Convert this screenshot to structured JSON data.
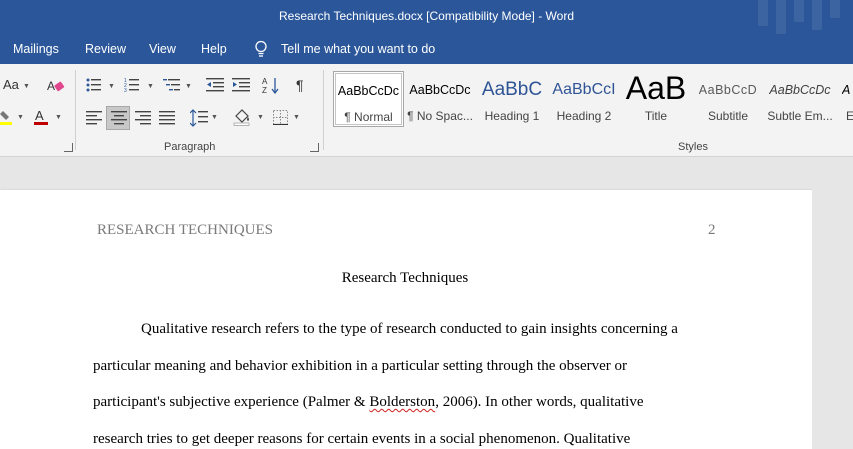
{
  "titlebar": {
    "title": "Research Techniques.docx [Compatibility Mode]  -  Word"
  },
  "menu": {
    "tabs": [
      "Mailings",
      "Review",
      "View",
      "Help"
    ],
    "tell_me": "Tell me what you want to do"
  },
  "ribbon": {
    "font_group": {
      "change_case": "Aa"
    },
    "paragraph_group": {
      "label": "Paragraph"
    },
    "styles_group": {
      "label": "Styles",
      "items": [
        {
          "preview": "AaBbCcDc",
          "name": "¶ Normal"
        },
        {
          "preview": "AaBbCcDc",
          "name": "¶ No Spac..."
        },
        {
          "preview": "AaBbC",
          "name": "Heading 1"
        },
        {
          "preview": "AaBbCcI",
          "name": "Heading 2"
        },
        {
          "preview": "AaB",
          "name": "Title"
        },
        {
          "preview": "AaBbCcD",
          "name": "Subtitle"
        },
        {
          "preview": "AaBbCcDc",
          "name": "Subtle Em..."
        },
        {
          "preview": "A",
          "name": "E"
        }
      ]
    },
    "colors": {
      "highlight": "#ffff00",
      "font_color": "#c00000"
    }
  },
  "document": {
    "header_left": "RESEARCH TECHNIQUES",
    "header_right": "2",
    "title": "Research Techniques",
    "lines": [
      "Qualitative research refers to the type of research conducted to gain insights concerning a",
      "particular meaning and behavior exhibition in a particular setting through the observer or",
      {
        "before": "participant's subjective experience (Palmer & ",
        "flagged": "Bolderston",
        "after": ", 2006). In other words, qualitative"
      },
      "research tries to get deeper reasons for certain events in a social phenomenon. Qualitative"
    ]
  }
}
